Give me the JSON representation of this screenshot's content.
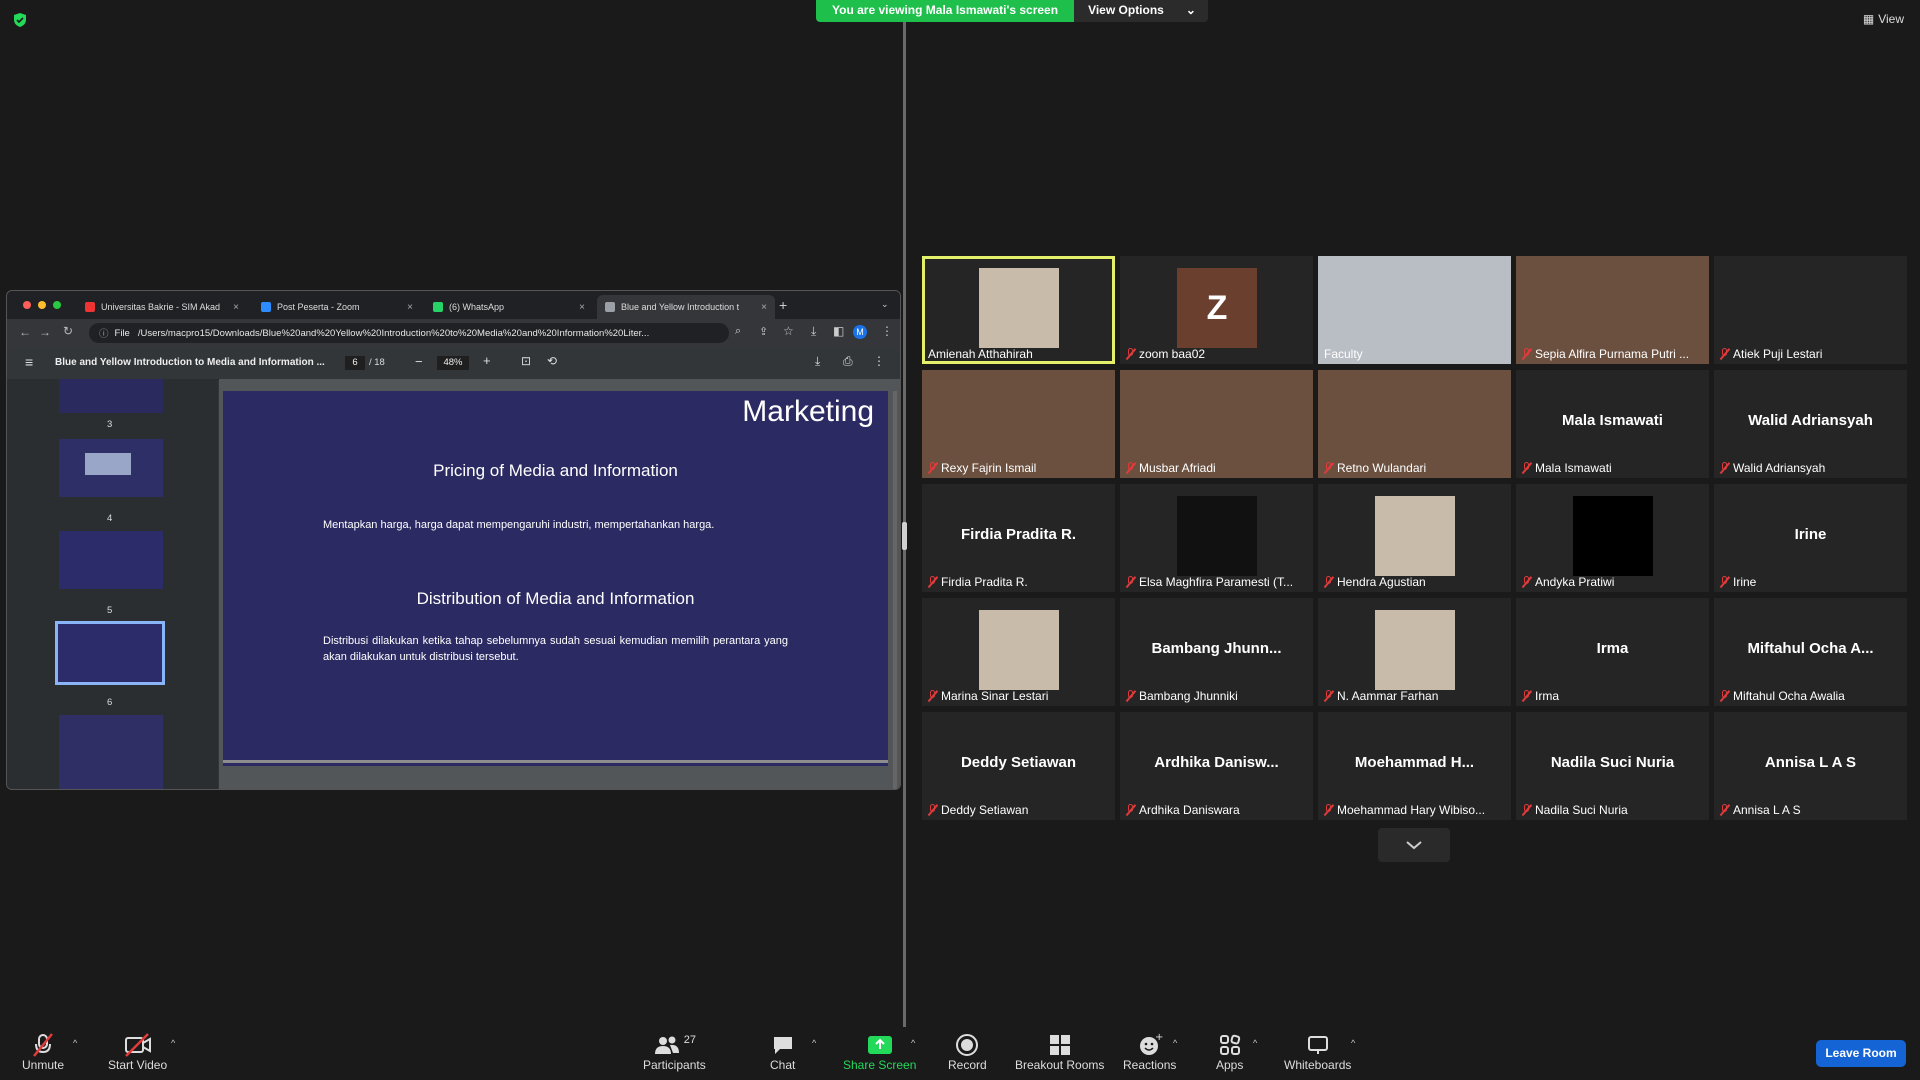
{
  "banner": {
    "viewing": "You are viewing Mala Ismawati's screen",
    "options": "View Options"
  },
  "view_label": "View",
  "browser": {
    "tabs": [
      {
        "label": "Universitas Bakrie - SIM Akad",
        "color": "#e33"
      },
      {
        "label": "Post Peserta - Zoom",
        "color": "#2d8cff"
      },
      {
        "label": "(6) WhatsApp",
        "color": "#25d366"
      },
      {
        "label": "Blue and Yellow Introduction t",
        "color": "#9aa0a6"
      }
    ],
    "url_prefix": "File",
    "url": "/Users/macpro15/Downloads/Blue%20and%20Yellow%20Introduction%20to%20Media%20and%20Information%20Liter...",
    "avatar": "M"
  },
  "pdf": {
    "title": "Blue and Yellow Introduction to Media and Information ...",
    "page": "6",
    "total": "/ 18",
    "zoom": "48%",
    "thumb_numbers": [
      "3",
      "4",
      "5",
      "6"
    ],
    "slide": {
      "heading": "Marketing",
      "s1_title": "Pricing of Media and Information",
      "s1_body": "Mentapkan harga, harga dapat mempengaruhi industri, mempertahankan harga.",
      "s2_title": "Distribution of Media and Information",
      "s2_body": "Distribusi dilakukan ketika tahap sebelumnya sudah sesuai kemudian memilih perantara yang akan dilakukan untuk distribusi tersebut."
    }
  },
  "participants": [
    {
      "name": "Amienah Atthahirah",
      "big": "",
      "video": "photo",
      "muted": false,
      "active": true
    },
    {
      "name": "zoom baa02",
      "big": "",
      "video": "avatar",
      "muted": true
    },
    {
      "name": "Faculty",
      "big": "",
      "video": "room",
      "muted": false
    },
    {
      "name": "Sepia Alfira Purnama Putri ...",
      "big": "",
      "video": "cam",
      "muted": true
    },
    {
      "name": "Atiek Puji Lestari",
      "big": "",
      "video": "none",
      "muted": true
    },
    {
      "name": "Rexy Fajrin Ismail",
      "big": "",
      "video": "cam",
      "muted": true
    },
    {
      "name": "Musbar Afriadi",
      "big": "",
      "video": "cam",
      "muted": true
    },
    {
      "name": "Retno Wulandari",
      "big": "",
      "video": "cam",
      "muted": true
    },
    {
      "name": "Mala Ismawati",
      "big": "Mala Ismawati",
      "video": "none",
      "muted": true
    },
    {
      "name": "Walid Adriansyah",
      "big": "Walid Adriansyah",
      "video": "none",
      "muted": true
    },
    {
      "name": "Firdia Pradita R.",
      "big": "Firdia Pradita R.",
      "video": "none",
      "muted": true
    },
    {
      "name": "Elsa Maghfira Paramesti (T...",
      "big": "",
      "video": "dark",
      "muted": true
    },
    {
      "name": "Hendra Agustian",
      "big": "",
      "video": "photo",
      "muted": true
    },
    {
      "name": "Andyka Pratiwi",
      "big": "",
      "video": "black",
      "muted": true
    },
    {
      "name": "Irine",
      "big": "Irine",
      "video": "none",
      "muted": true
    },
    {
      "name": "Marina Sinar Lestari",
      "big": "",
      "video": "photo",
      "muted": true
    },
    {
      "name": "Bambang Jhunniki",
      "big": "Bambang Jhunn...",
      "video": "none",
      "muted": true
    },
    {
      "name": "N. Aammar Farhan",
      "big": "",
      "video": "photo",
      "muted": true
    },
    {
      "name": "Irma",
      "big": "Irma",
      "video": "none",
      "muted": true
    },
    {
      "name": "Miftahul Ocha Awalia",
      "big": "Miftahul Ocha A...",
      "video": "none",
      "muted": true
    },
    {
      "name": "Deddy Setiawan",
      "big": "Deddy Setiawan",
      "video": "none",
      "muted": true
    },
    {
      "name": "Ardhika Daniswara",
      "big": "Ardhika Danisw...",
      "video": "none",
      "muted": true
    },
    {
      "name": "Moehammad Hary Wibiso...",
      "big": "Moehammad H...",
      "video": "none",
      "muted": true
    },
    {
      "name": "Nadila Suci Nuria",
      "big": "Nadila Suci Nuria",
      "video": "none",
      "muted": true
    },
    {
      "name": "Annisa L A S",
      "big": "Annisa L A S",
      "video": "none",
      "muted": true
    }
  ],
  "avatar_letter": "Z",
  "toolbar": {
    "unmute": "Unmute",
    "start_video": "Start Video",
    "participants": "Participants",
    "participants_count": "27",
    "chat": "Chat",
    "share": "Share Screen",
    "record": "Record",
    "breakout": "Breakout Rooms",
    "reactions": "Reactions",
    "apps": "Apps",
    "whiteboards": "Whiteboards",
    "leave": "Leave Room"
  },
  "colors": {
    "share_green": "#23d959",
    "leave_blue": "#1564d6",
    "mute_red": "#e03b3b",
    "active_outline": "#e5f06a"
  }
}
